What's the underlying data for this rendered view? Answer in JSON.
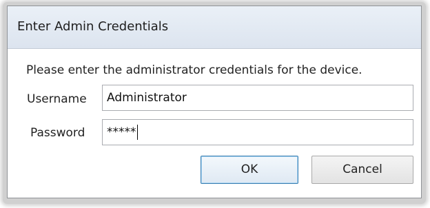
{
  "dialog": {
    "title": "Enter Admin Credentials",
    "prompt": "Please enter the administrator credentials for the device."
  },
  "form": {
    "username_label": "Username",
    "username_value": "Administrator",
    "password_label": "Password",
    "password_value": "*****"
  },
  "buttons": {
    "ok_label": "OK",
    "cancel_label": "Cancel"
  }
}
